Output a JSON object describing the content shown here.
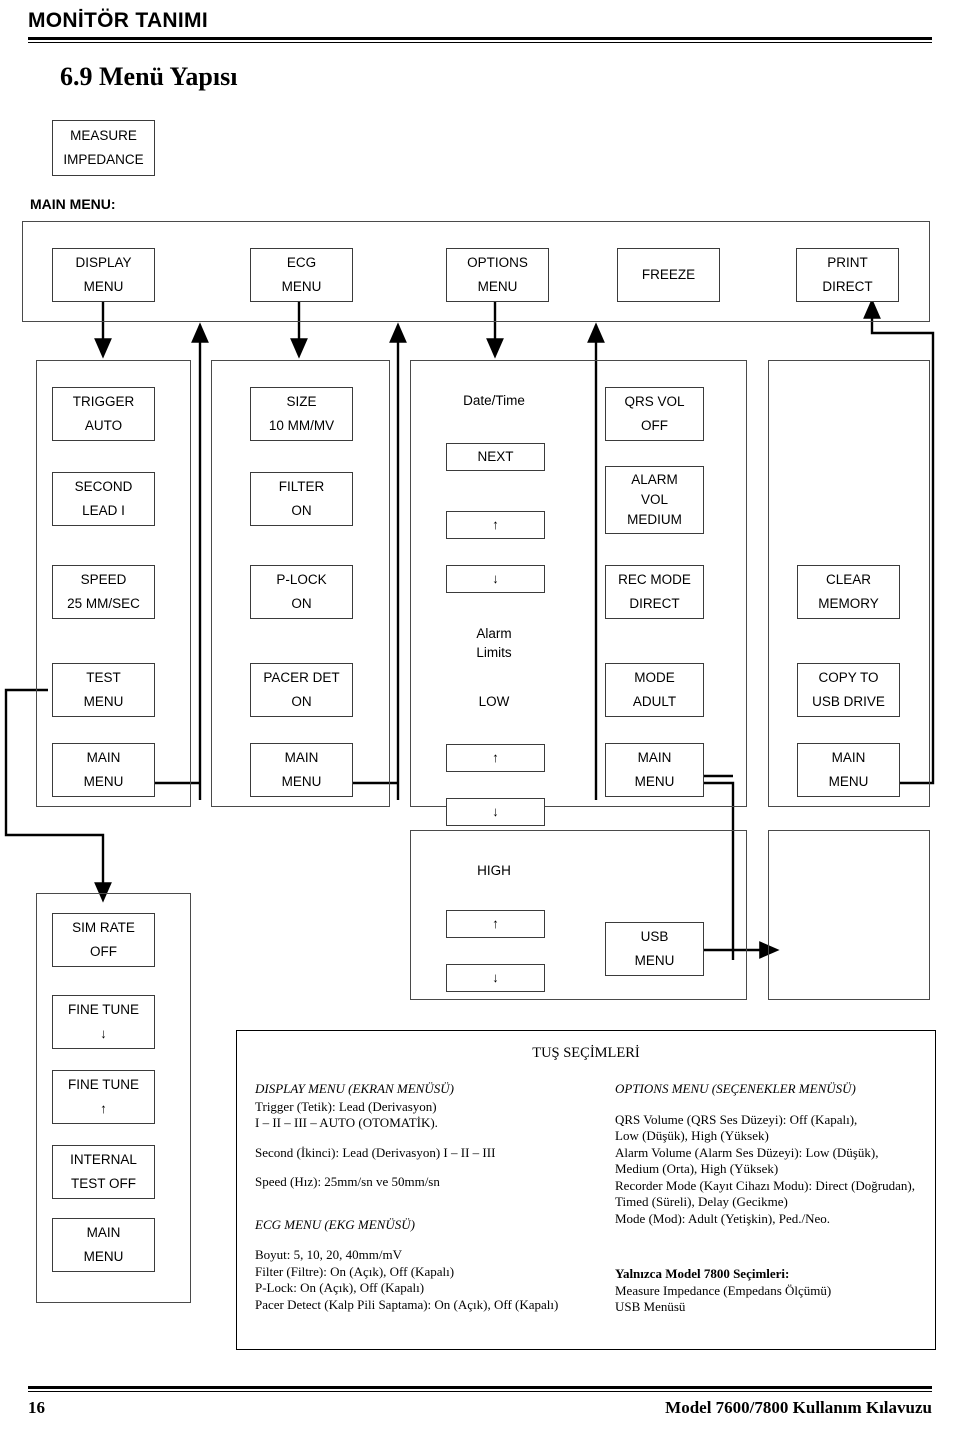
{
  "header": {
    "title": "MONİTÖR TANIMI"
  },
  "section": {
    "heading": "6.9 Menü Yapısı"
  },
  "measure_impedance": {
    "line1": "MEASURE",
    "line2": "IMPEDANCE"
  },
  "main_menu_caption": "MAIN MENU:",
  "main_menu_row": [
    {
      "line1": "DISPLAY",
      "line2": "MENU"
    },
    {
      "line1": "ECG",
      "line2": "MENU"
    },
    {
      "line1": "OPTIONS",
      "line2": "MENU"
    },
    {
      "line1": "FREEZE",
      "line2": ""
    },
    {
      "line1": "PRINT",
      "line2": "DIRECT"
    }
  ],
  "display_column": [
    {
      "line1": "TRIGGER",
      "line2": "AUTO"
    },
    {
      "line1": "SECOND",
      "line2": "LEAD I"
    },
    {
      "line1": "SPEED",
      "line2": "25 MM/SEC"
    },
    {
      "line1": "TEST",
      "line2": "MENU"
    },
    {
      "line1": "MAIN",
      "line2": "MENU"
    }
  ],
  "ecg_column": [
    {
      "line1": "SIZE",
      "line2": "10 MM/MV"
    },
    {
      "line1": "FILTER",
      "line2": "ON"
    },
    {
      "line1": "P-LOCK",
      "line2": "ON"
    },
    {
      "line1": "PACER DET",
      "line2": "ON"
    },
    {
      "line1": "MAIN",
      "line2": "MENU"
    }
  ],
  "options_center_column": {
    "date_time_label": "Date/Time",
    "next_button": "NEXT",
    "up_1": "↑",
    "down_1": "↓",
    "alarm_limits_label_line1": "Alarm",
    "alarm_limits_label_line2": "Limits",
    "low_label": "LOW",
    "up_2": "↑",
    "down_2": "↓",
    "high_label": "HIGH",
    "up_3": "↑",
    "down_3": "↓"
  },
  "options_column": [
    {
      "line1": "QRS VOL",
      "line2": "OFF"
    },
    {
      "line1": "ALARM",
      "line2": "VOL",
      "line3": "MEDIUM"
    },
    {
      "line1": "REC MODE",
      "line2": "DIRECT"
    },
    {
      "line1": "MODE",
      "line2": "ADULT"
    },
    {
      "line1": "MAIN",
      "line2": "MENU"
    }
  ],
  "print_column": [
    {
      "line1": "CLEAR",
      "line2": "MEMORY"
    },
    {
      "line1": "COPY TO",
      "line2": "USB DRIVE"
    },
    {
      "line1": "MAIN",
      "line2": "MENU"
    }
  ],
  "usb_menu": {
    "line1": "USB",
    "line2": "MENU"
  },
  "test_menu_column": [
    {
      "line1": "SIM RATE",
      "line2": "OFF"
    },
    {
      "line1": "FINE TUNE",
      "line2": "↓"
    },
    {
      "line1": "FINE TUNE",
      "line2": "↑"
    },
    {
      "line1": "INTERNAL",
      "line2": "TEST OFF"
    },
    {
      "line1": "MAIN",
      "line2": "MENU"
    }
  ],
  "keys_panel": {
    "title": "TUŞ SEÇİMLERİ",
    "left": {
      "display_menu_title": "DISPLAY MENU (EKRAN MENÜSÜ)",
      "display_line1": "Trigger (Tetik): Lead (Derivasyon)",
      "display_line2": "I – II – III – AUTO (OTOMATİK).",
      "display_line3": "Second (İkinci): Lead (Derivasyon) I – II – III",
      "display_line4": "Speed (Hız): 25mm/sn ve 50mm/sn",
      "ecg_menu_title": "ECG MENU (EKG MENÜSÜ)",
      "ecg_line1": "Boyut: 5, 10, 20, 40mm/mV",
      "ecg_line2": "Filter (Filtre): On (Açık), Off (Kapalı)",
      "ecg_line3": "P-Lock: On (Açık), Off (Kapalı)",
      "ecg_line4": "Pacer Detect (Kalp Pili Saptama): On (Açık), Off (Kapalı)"
    },
    "right": {
      "options_menu_title": "OPTIONS MENU (SEÇENEKLER MENÜSÜ)",
      "options_line1": "QRS Volume (QRS Ses Düzeyi): Off (Kapalı),",
      "options_line2": "Low (Düşük), High (Yüksek)",
      "options_line3": "Alarm Volume (Alarm Ses Düzeyi): Low (Düşük),",
      "options_line4": "Medium (Orta), High (Yüksek)",
      "options_line5": "Recorder Mode (Kayıt Cihazı Modu): Direct (Doğrudan),",
      "options_line6": "Timed (Süreli), Delay (Gecikme)",
      "options_line7": "Mode (Mod): Adult (Yetişkin), Ped./Neo.",
      "model7800_title": "Yalnızca Model 7800 Seçimleri:",
      "model7800_line1": "Measure Impedance (Empedans Ölçümü)",
      "model7800_line2": "USB Menüsü"
    }
  },
  "footer": {
    "page_number": "16",
    "manual": "Model 7600/7800 Kullanım Kılavuzu"
  }
}
